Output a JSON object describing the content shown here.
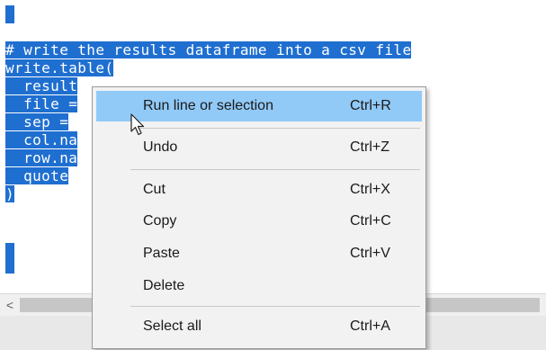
{
  "editor": {
    "lines": [
      "# write the results dataframe into a csv file",
      "write.table(",
      "  result",
      "  file =",
      "  sep =",
      "  col.na",
      "  row.na",
      "  quote",
      ")"
    ]
  },
  "scrollbar": {
    "left_arrow": "<"
  },
  "context_menu": {
    "items": [
      {
        "label": "Run line or selection",
        "shortcut": "Ctrl+R"
      },
      {
        "label": "Undo",
        "shortcut": "Ctrl+Z"
      },
      {
        "label": "Cut",
        "shortcut": "Ctrl+X"
      },
      {
        "label": "Copy",
        "shortcut": "Ctrl+C"
      },
      {
        "label": "Paste",
        "shortcut": "Ctrl+V"
      },
      {
        "label": "Delete",
        "shortcut": ""
      },
      {
        "label": "Select all",
        "shortcut": "Ctrl+A"
      }
    ],
    "highlighted_item": "Run line or selection"
  },
  "colors": {
    "selection": "#1f6fd0",
    "menu_highlight": "#91c9f7",
    "menu_background": "#f2f2f2"
  }
}
